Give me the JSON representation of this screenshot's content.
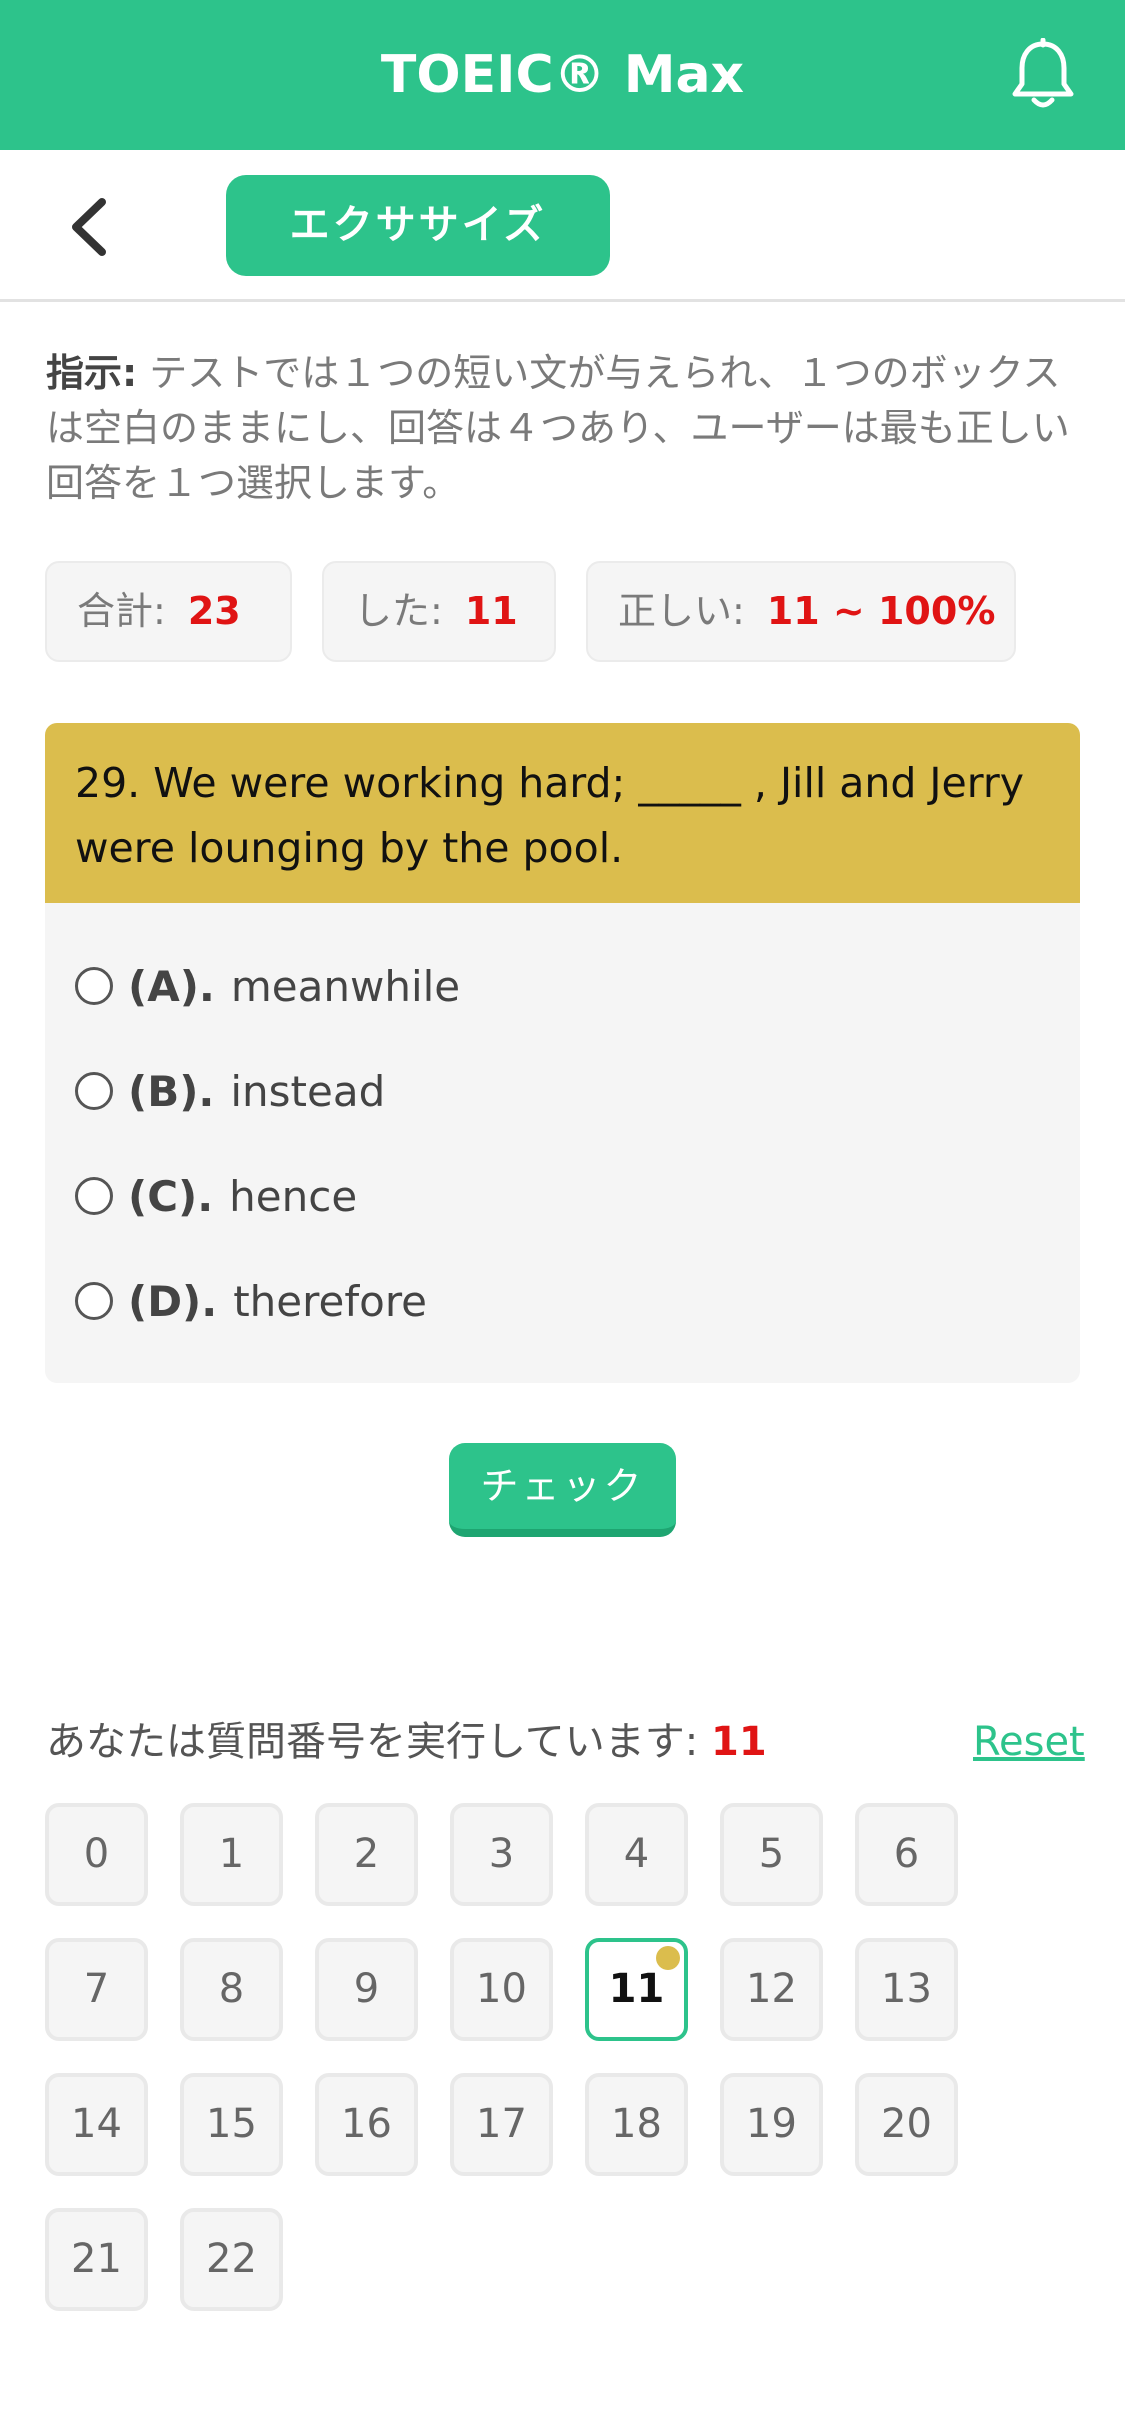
{
  "app": {
    "title": "TOEIC® Max"
  },
  "subbar": {
    "tab_label": "エクササイズ"
  },
  "instruction": {
    "label": "指示:",
    "text": " テストでは１つの短い文が与えられ、１つのボックスは空白のままにし、回答は４つあり、ユーザーは最も正しい回答を１つ選択します。"
  },
  "stats": {
    "total_label": "合計:",
    "total_value": "23",
    "done_label": "した:",
    "done_value": "11",
    "correct_label": "正しい:",
    "correct_value": "11 ~ 100%"
  },
  "question": {
    "text": "29. We were working hard; _____ , Jill and Jerry were lounging by the pool.",
    "options": [
      {
        "letter": "(A).",
        "text": "meanwhile"
      },
      {
        "letter": "(B).",
        "text": "instead"
      },
      {
        "letter": "(C).",
        "text": "hence"
      },
      {
        "letter": "(D).",
        "text": "therefore"
      }
    ]
  },
  "check_label": "チェック",
  "progress": {
    "running_label": "あなたは質問番号を実行しています:",
    "current": "11",
    "reset_label": "Reset"
  },
  "question_numbers": [
    "0",
    "1",
    "2",
    "3",
    "4",
    "5",
    "6",
    "7",
    "8",
    "9",
    "10",
    "11",
    "12",
    "13",
    "14",
    "15",
    "16",
    "17",
    "18",
    "19",
    "20",
    "21",
    "22"
  ],
  "colors": {
    "primary": "#2dc38b",
    "question_header": "#dbbd4d",
    "accent_red": "#e01414"
  }
}
